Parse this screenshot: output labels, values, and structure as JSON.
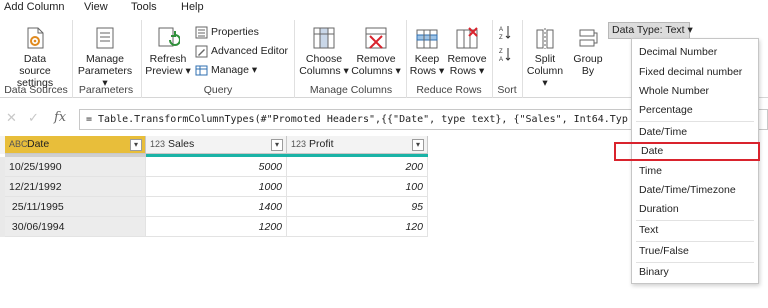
{
  "menu": {
    "items": [
      "Add Column",
      "View",
      "Tools",
      "Help"
    ]
  },
  "ribbon": {
    "data_source_settings": "Data source settings",
    "manage_parameters_line1": "Manage",
    "manage_parameters_line2": "Parameters ▾",
    "refresh_line1": "Refresh",
    "refresh_line2": "Preview ▾",
    "properties": "Properties",
    "advanced_editor": "Advanced Editor",
    "manage": "Manage ▾",
    "choose_columns_line1": "Choose",
    "choose_columns_line2": "Columns ▾",
    "remove_columns_line1": "Remove",
    "remove_columns_line2": "Columns ▾",
    "keep_rows_line1": "Keep",
    "keep_rows_line2": "Rows ▾",
    "remove_rows_line1": "Remove",
    "remove_rows_line2": "Rows ▾",
    "split_column_line1": "Split",
    "split_column_line2": "Column ▾",
    "group_by_line1": "Group",
    "group_by_line2": "By",
    "data_type_button": "Data Type: Text ▾",
    "groups": {
      "data_sources": "Data Sources",
      "parameters": "Parameters",
      "query": "Query",
      "manage_columns": "Manage Columns",
      "reduce_rows": "Reduce Rows",
      "sort": "Sort"
    }
  },
  "formula": {
    "cancel_glyph": "✕",
    "accept_glyph": "✓",
    "fx_glyph": "fx",
    "text": "= Table.TransformColumnTypes(#\"Promoted Headers\",{{\"Date\", type text}, {\"Sales\", Int64.Typ"
  },
  "table": {
    "columns": [
      {
        "type_icon": "ABC",
        "label": "Date"
      },
      {
        "type_icon": "123",
        "label": "Sales"
      },
      {
        "type_icon": "123",
        "label": "Profit"
      }
    ],
    "rows": [
      [
        "10/25/1990",
        "5000",
        "200"
      ],
      [
        "12/21/1992",
        "1000",
        "100"
      ],
      [
        " 25/11/1995",
        "1400",
        "95"
      ],
      [
        " 30/06/1994",
        "1200",
        "120"
      ]
    ]
  },
  "data_type_menu": {
    "items": [
      "Decimal Number",
      "Fixed decimal number",
      "Whole Number",
      "Percentage",
      "Date/Time",
      "Date",
      "Time",
      "Date/Time/Timezone",
      "Duration",
      "Text",
      "True/False",
      "Binary"
    ],
    "highlighted": "Date",
    "highlight_color": "#d9232d"
  },
  "colors": {
    "accent_header": "#e8be3a",
    "teal_bar": "#1ab3a6",
    "row_header_bg": "#e9e9e9"
  }
}
